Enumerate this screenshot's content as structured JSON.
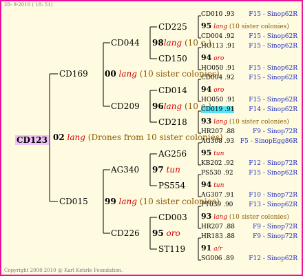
{
  "header": {
    "date": "28-  9-2010 ( 18: 51)"
  },
  "footer": {
    "copyright": "Copyright 2008-2010 @ Karl Kehrle Foundation."
  },
  "root": {
    "label": "CD123",
    "gen_num": "02",
    "note": "lang",
    "extra": "(Drones from 10 sister colonies)"
  },
  "gen1": [
    {
      "label": "CD169"
    },
    {
      "label": "CD015"
    }
  ],
  "gen1_notes": [
    {
      "num": "00",
      "note": "lang",
      "extra": "(10 sister colonies)"
    },
    {
      "num": "99",
      "note": "lang",
      "extra": "(10 sister colonies)"
    }
  ],
  "gen2": [
    {
      "label": "CD044"
    },
    {
      "label": "CD209"
    },
    {
      "label": "AG340"
    },
    {
      "label": "CD226"
    }
  ],
  "gen2_notes": [
    {
      "num": "98",
      "note": "lang",
      "extra": "(10 c.)"
    },
    {
      "num": "96",
      "note": "lang",
      "extra": "(10 c.)"
    },
    {
      "num": "97",
      "note": "tun",
      "extra": ""
    },
    {
      "num": "95",
      "note": "oro",
      "extra": ""
    }
  ],
  "gen3": [
    {
      "label": "CD225"
    },
    {
      "label": "CD150"
    },
    {
      "label": "CD014"
    },
    {
      "label": "CD218"
    },
    {
      "label": "AG256"
    },
    {
      "label": "PS554"
    },
    {
      "label": "CD003"
    },
    {
      "label": "ST119"
    }
  ],
  "gen4": [
    {
      "top": "CD010 .93",
      "top_code": "F15 - Sinop62R",
      "num": "95",
      "note": "lang",
      "extra": "(10 sister colonies)",
      "bot": "CD004 .92",
      "bot_code": "F15 - Sinop62R"
    },
    {
      "top": "HO113 .91",
      "top_code": "F15 - Sinop62R",
      "num": "94",
      "note": "oro",
      "extra": "",
      "bot": "HO050 .91",
      "bot_code": "F15 - Sinop62R"
    },
    {
      "top": "CD004 .92",
      "top_code": "F15 - Sinop62R",
      "num": "94",
      "note": "oro",
      "extra": "",
      "bot": "HO050 .91",
      "bot_code": "F15 - Sinop62R"
    },
    {
      "top": "CD019 .91",
      "top_code": "F14 - Sinop62R",
      "num": "93",
      "note": "lang",
      "extra": "(10 sister colonies)",
      "bot": "HR207 .88",
      "bot_code": "F9 - Sinop72R"
    },
    {
      "top": "AG308 .93",
      "top_code": "F5 - SinopEgg86R",
      "num": "95",
      "note": "tun",
      "extra": "",
      "bot": "KB202 .92",
      "bot_code": "F12 - Sinop72R"
    },
    {
      "top": "PS530 .92",
      "top_code": "F15 - Sinop62R",
      "num": "94",
      "note": "tun",
      "extra": "",
      "bot": "AG307 .91",
      "bot_code": "F10 - Sinop72R"
    },
    {
      "top": "PT039 .90",
      "top_code": "F13 - Sinop62R",
      "num": "93",
      "note": "lang",
      "extra": "(10 sister colonies)",
      "bot": "HR207 .88",
      "bot_code": "F9 - Sinop72R"
    },
    {
      "top": "HR183 .88",
      "top_code": "F9 - Sinop72R",
      "num": "91",
      "note": "a/r",
      "extra": "",
      "bot": "SG006 .89",
      "bot_code": "F12 - Sinop62R"
    }
  ]
}
